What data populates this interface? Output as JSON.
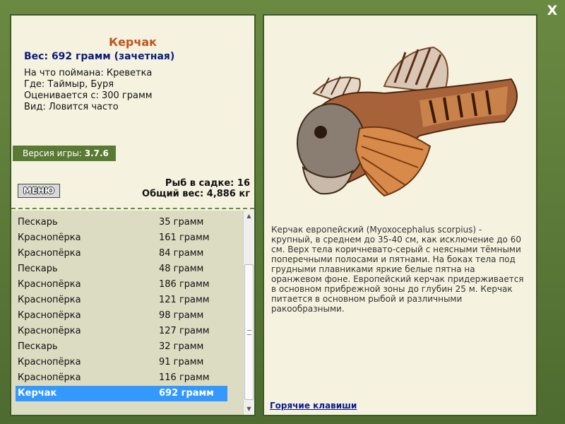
{
  "close_label": "X",
  "fish": {
    "name": "Керчак",
    "weight_line": "Вес: 692 грамм (зачетная)",
    "caught_on": "На что поймана: Креветка",
    "location": "Где: Таймыр, Буря",
    "value": "Оценивается с: 300 грамм",
    "kind": "Вид: Ловится часто"
  },
  "version": {
    "label": "Версия игры:",
    "number": "3.7.6"
  },
  "menu_label": "МЕНЮ",
  "stats": {
    "count": "Рыб в садке: 16",
    "total": "Общий вес: 4,886 кг"
  },
  "catch_list": [
    {
      "name": "Пескарь",
      "weight": "35 грамм"
    },
    {
      "name": "Краснопёрка",
      "weight": "161 грамм"
    },
    {
      "name": "Краснопёрка",
      "weight": "84 грамм"
    },
    {
      "name": "Пескарь",
      "weight": "48 грамм"
    },
    {
      "name": "Краснопёрка",
      "weight": "186 грамм"
    },
    {
      "name": "Краснопёрка",
      "weight": "121 грамм"
    },
    {
      "name": "Краснопёрка",
      "weight": "98 грамм"
    },
    {
      "name": "Краснопёрка",
      "weight": "127 грамм"
    },
    {
      "name": "Пескарь",
      "weight": "32 грамм"
    },
    {
      "name": "Краснопёрка",
      "weight": "91 грамм"
    },
    {
      "name": "Краснопёрка",
      "weight": "116 грамм"
    },
    {
      "name": "Керчак",
      "weight": "692 грамм"
    }
  ],
  "selected_index": 11,
  "description": "Керчак европейский (Myoxocephalus scorpius) - крупный, в среднем до 35-40 см, как исключение до 60 см. Верх тела коричневато-серый с неясными тёмными поперечными полосами и пятнами. На боках тела под грудными плавниками яркие белые пятна на оранжевом фоне. Европейский керчак придерживается в основном прибрежной зоны до глубин 25 м. Керчак питается в основном рыбой и различными ракообразными.",
  "hotkeys_label": "Горячие клавиши",
  "colors": {
    "frame": "#5b7a3a",
    "panel": "#f5f3df",
    "title": "#c0551b",
    "weight": "#0a1a7a",
    "selection": "#3399ff"
  }
}
